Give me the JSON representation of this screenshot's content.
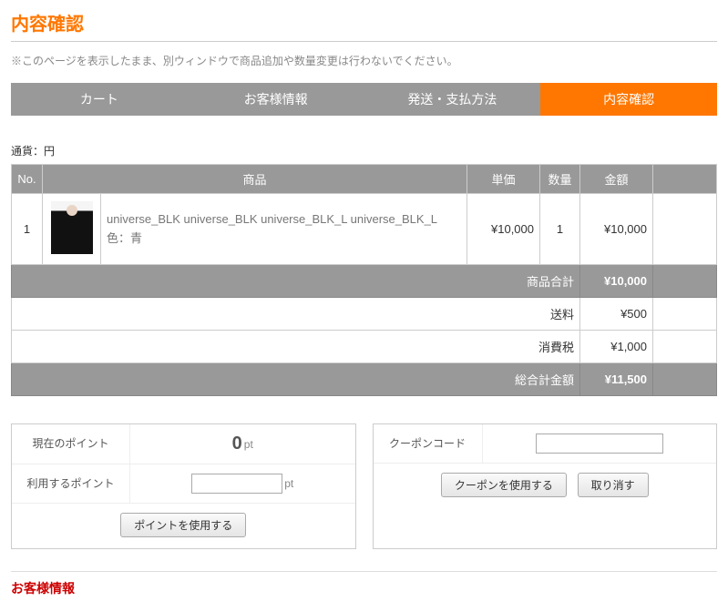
{
  "page_title": "内容確認",
  "notice": "※このページを表示したまま、別ウィンドウで商品追加や数量変更は行わないでください。",
  "steps": [
    {
      "label": "カート",
      "active": false
    },
    {
      "label": "お客様情報",
      "active": false
    },
    {
      "label": "発送・支払方法",
      "active": false
    },
    {
      "label": "内容確認",
      "active": true
    }
  ],
  "currency_label": "通貨：円",
  "table": {
    "headers": {
      "no": "No.",
      "product": "商品",
      "unit_price": "単価",
      "qty": "数量",
      "amount": "金額"
    },
    "rows": [
      {
        "no": "1",
        "name": "universe_BLK universe_BLK universe_BLK_L universe_BLK_L",
        "color_line": "色：青",
        "unit_price": "¥10,000",
        "qty": "1",
        "amount": "¥10,000"
      }
    ],
    "summary": {
      "subtotal_label": "商品合計",
      "subtotal": "¥10,000",
      "shipping_label": "送料",
      "shipping": "¥500",
      "tax_label": "消費税",
      "tax": "¥1,000",
      "total_label": "総合計金額",
      "total": "¥11,500"
    }
  },
  "points": {
    "current_label": "現在のポイント",
    "current_value": "0",
    "current_unit": "pt",
    "use_label": "利用するポイント",
    "use_unit": "pt",
    "use_value": "",
    "apply_button": "ポイントを使用する"
  },
  "coupon": {
    "label": "クーポンコード",
    "value": "",
    "apply_button": "クーポンを使用する",
    "cancel_button": "取り消す"
  },
  "customer_info_title": "お客様情報"
}
